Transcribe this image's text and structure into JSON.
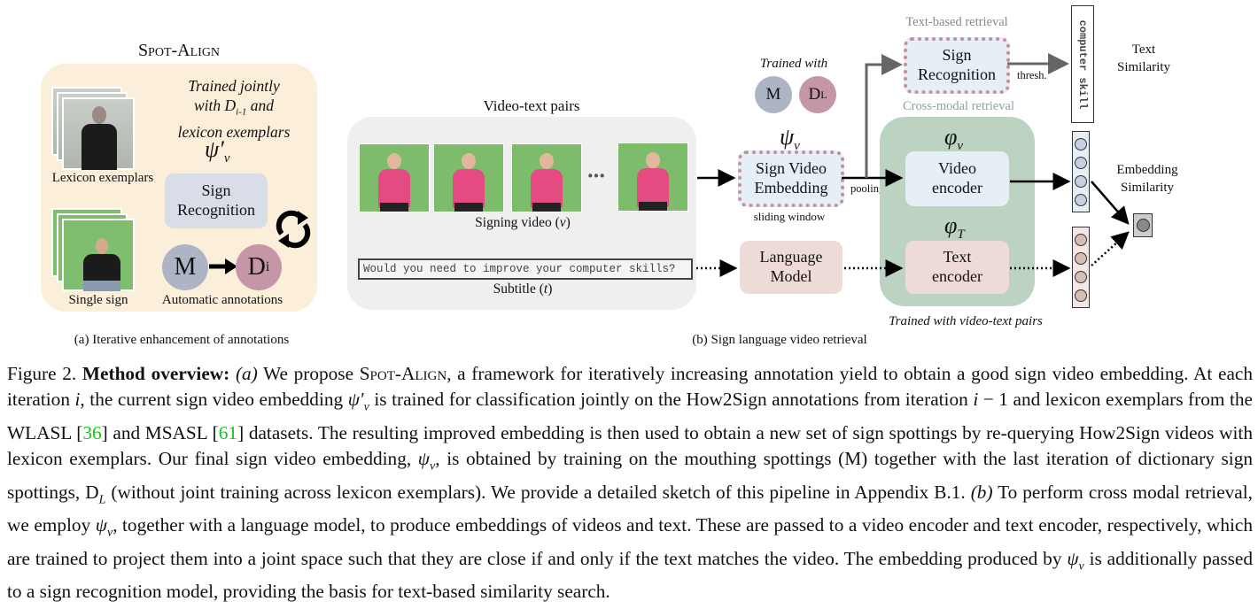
{
  "panel_a": {
    "title": "Spot-Align",
    "trained_note_line1": "Trained jointly",
    "trained_note_line2_prefix": "with ",
    "trained_note_line2_var": "D",
    "trained_note_line2_sub": "i-1",
    "trained_note_line2_suffix": " and",
    "trained_note_line3": "lexicon exemplars",
    "psi_prime_symbol": "ψ′",
    "psi_sub": "v",
    "lexicon_label": "Lexicon exemplars",
    "single_sign_label": "Single sign",
    "sign_recognition_line1": "Sign",
    "sign_recognition_line2": "Recognition",
    "m_label": "M",
    "d_label": "D",
    "d_sub": "i",
    "automatic_annotations_label": "Automatic annotations",
    "subcaption": "(a) Iterative enhancement of annotations"
  },
  "panel_b": {
    "video_text_pairs_title": "Video-text pairs",
    "ellipsis": "···",
    "signing_video_label": "Signing video (",
    "signing_video_var": "v",
    "signing_video_close": ")",
    "subtitle_text": "Would you need to improve your computer skills?",
    "subtitle_label": "Subtitle (",
    "subtitle_var": "t",
    "subtitle_close": ")",
    "trained_with_label": "Trained with",
    "m_label": "M",
    "dl_label": "D",
    "dl_sub": "L",
    "psi_symbol": "ψ",
    "psi_sub": "v",
    "sign_video_embedding_line1": "Sign Video",
    "sign_video_embedding_line2": "Embedding",
    "sliding_window_label": "sliding window",
    "pooling_label": "pooling",
    "text_based_retrieval_label": "Text-based retrieval",
    "sign_recognition_line1": "Sign",
    "sign_recognition_line2": "Recognition",
    "thresh_label": "thresh.",
    "text_vector_text": "computer skill",
    "text_similarity_line1": "Text",
    "text_similarity_line2": "Similarity",
    "cross_modal_label": "Cross-modal retrieval",
    "phi_v_symbol": "φ",
    "phi_v_sub": "v",
    "video_encoder_line1": "Video",
    "video_encoder_line2": "encoder",
    "phi_t_symbol": "φ",
    "phi_t_sub": "T",
    "text_encoder_line1": "Text",
    "text_encoder_line2": "encoder",
    "language_model_line1": "Language",
    "language_model_line2": "Model",
    "embedding_similarity_line1": "Embedding",
    "embedding_similarity_line2": "Similarity",
    "trained_video_text_label": "Trained with video-text pairs",
    "subcaption": "(b) Sign language video retrieval"
  },
  "colors": {
    "panel_a_bg": "#fcefd9",
    "video_text_bg": "#efefee",
    "cross_modal_bg": "#bdd3c2",
    "m_circle": "#adb5c4",
    "d_circle": "#c596a8",
    "sign_recog_a": "#d9dde8",
    "blue_box": "#e6eef6",
    "pink_box": "#eedbd8",
    "text_based_label": "#888888",
    "cross_modal_label": "#8aa892",
    "video_vec": "#e6eef6",
    "video_vec_dot": "#c6d0e0",
    "text_vec": "#f4e6e4",
    "text_vec_dot": "#d6bdb6",
    "ref_green": "#18c418"
  },
  "caption": {
    "fig_label": "Figure 2. ",
    "bold_lead": "Method overview:",
    "a_marker": " (a)",
    "p1": " We propose ",
    "spot_align": "Spot-Align",
    "p2": ", a framework for iteratively increasing annotation yield to obtain a good sign video embedding. At each iteration ",
    "var_i": "i",
    "p3": ", the current sign video embedding ",
    "psi_prime": "ψ′",
    "sub_v": "v",
    "p4": " is trained for classification jointly on the How2Sign annotations from iteration ",
    "var_i2": "i",
    "p5": " − 1 and lexicon exemplars from the WLASL [",
    "ref1": "36",
    "p6": "] and MSASL [",
    "ref2": "61",
    "p7": "] datasets. The resulting improved embedding is then used to obtain a new set of sign spottings by re-querying How2Sign videos with lexicon exemplars. Our final sign video embedding, ",
    "psi": "ψ",
    "sub_v2": "v",
    "p8": ", is obtained by training on the mouthing spottings (M) together with the last iteration of dictionary sign spottings, D",
    "sub_L": "L",
    "p9": " (without joint training across lexicon exemplars). We provide a detailed sketch of this pipeline in Appendix B.1. ",
    "b_marker": " (b)",
    "p10": " To perform cross modal retrieval, we employ ",
    "psi2": "ψ",
    "sub_v3": "v",
    "p11": ", together with a language model, to produce embeddings of videos and text. These are passed to a video encoder and text encoder, respectively, which are trained to project them into a joint space such that they are close if and only if the text matches the video. The embedding produced by ",
    "psi3": "ψ",
    "sub_v4": "v",
    "p12": " is additionally passed to a sign recognition model, providing the basis for text-based similarity search."
  }
}
